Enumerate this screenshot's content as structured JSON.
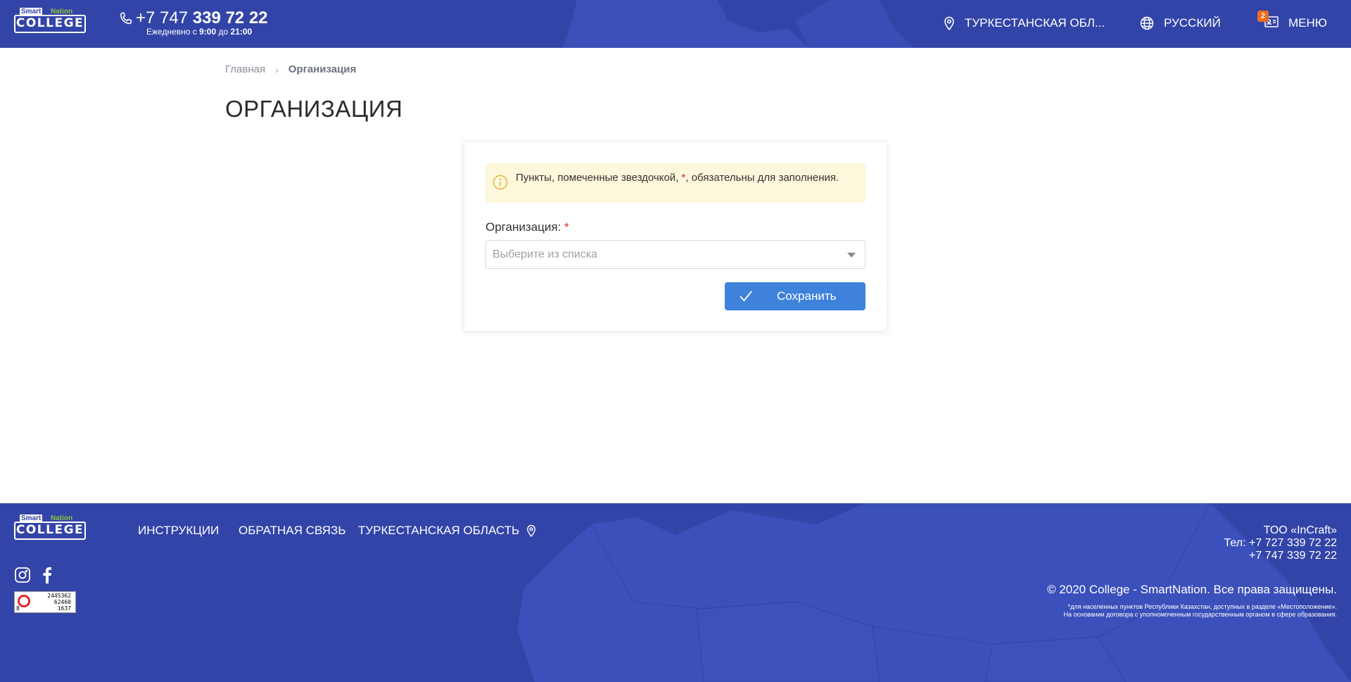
{
  "header": {
    "logo": {
      "smart": "Smart",
      "nation": "Nation",
      "college": "COLLEGE"
    },
    "phone": {
      "prefix": "+7 747",
      "number": "339 72 22",
      "hours_prefix": "Ежедневно с",
      "hours_from": "9:00",
      "hours_mid": "до",
      "hours_to": "21:00"
    },
    "region": "ТУРКЕСТАНСКАЯ ОБЛ...",
    "language": "РУССКИЙ",
    "menu": {
      "label": "МЕНЮ",
      "badge": "2"
    }
  },
  "breadcrumb": {
    "home": "Главная",
    "separator": "›",
    "current": "Организация"
  },
  "page_title": "ОРГАНИЗАЦИЯ",
  "form": {
    "notice": {
      "before": "Пункты, помеченные звездочкой,",
      "star": "*",
      "after": ", обязательны для заполнения."
    },
    "field_label": "Организация:",
    "required_mark": "*",
    "select_placeholder": "Выберите из списка",
    "save_label": "Сохранить"
  },
  "footer": {
    "logo": {
      "smart": "Smart",
      "nation": "Nation",
      "college": "COLLEGE"
    },
    "nav": {
      "instructions": "ИНСТРУКЦИИ",
      "feedback": "ОБРАТНАЯ СВЯЗЬ",
      "region": "ТУРКЕСТАНСКАЯ ОБЛАСТЬ"
    },
    "counter": {
      "line1": "2445362",
      "line2": "62460",
      "line3": "1637",
      "left": "8"
    },
    "company": "ТОО «InCraft»",
    "tel1": "Тел: +7 727 339 72 22",
    "tel2": "+7 747 339 72 22",
    "copyright": "© 2020 College - SmartNation. Все права защищены.",
    "note1": "*для населенных пунктов Республики Казахстан, доступных в разделе «Местоположение».",
    "note2": "На основании договора с уполномоченным государственным органом в сфере образования."
  },
  "colors": {
    "brand_blue": "#3344a8",
    "button_blue": "#3f82dc",
    "notice_bg": "#fdf7db",
    "badge_orange": "#f26b1d",
    "logo_green": "#8ac43f"
  },
  "icons": [
    "phone-icon",
    "location-pin-icon",
    "globe-icon",
    "profile-card-icon",
    "info-icon",
    "chevron-down-icon",
    "checkmark-icon",
    "instagram-icon",
    "facebook-icon"
  ]
}
